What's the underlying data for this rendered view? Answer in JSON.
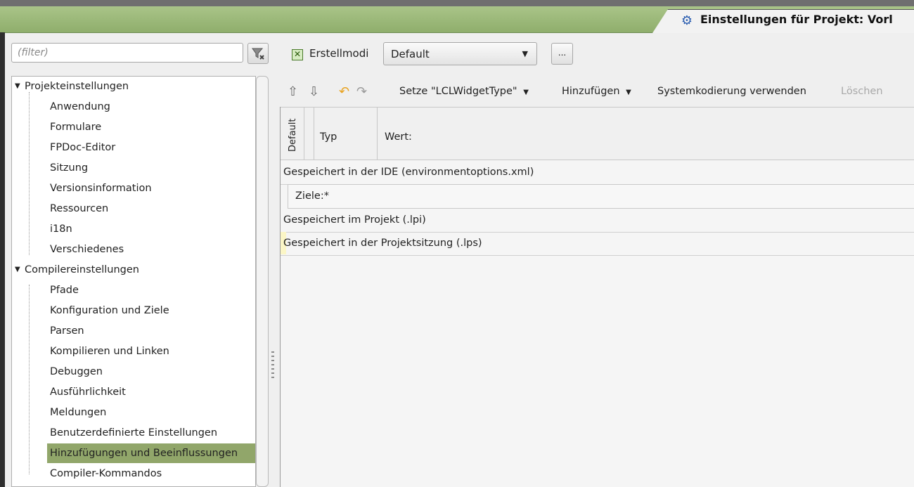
{
  "window": {
    "title": "Einstellungen für Projekt: Vorl",
    "title_icon": "gear-icon"
  },
  "sidebar": {
    "filter_placeholder": "(filter)",
    "filter_button_icon": "clear-filter-icon",
    "groups": [
      {
        "label": "Projekteinstellungen",
        "expanded": true,
        "items": [
          "Anwendung",
          "Formulare",
          "FPDoc-Editor",
          "Sitzung",
          "Versionsinformation",
          "Ressourcen",
          "i18n",
          "Verschiedenes"
        ]
      },
      {
        "label": "Compilereinstellungen",
        "expanded": true,
        "items": [
          "Pfade",
          "Konfiguration und Ziele",
          "Parsen",
          "Kompilieren und Linken",
          "Debuggen",
          "Ausführlichkeit",
          "Meldungen",
          "Benutzerdefinierte Einstellungen",
          "Hinzufügungen und Beeinflussungen",
          "Compiler-Kommandos"
        ]
      }
    ],
    "selected": "Hinzufügungen und Beeinflussungen",
    "selected_color": "#91a66a"
  },
  "buildmodes": {
    "checkbox_label": "Erstellmodi",
    "checked": true,
    "combo_value": "Default",
    "dots_label": "..."
  },
  "toolbar": {
    "move_up_icon": "arrow-up-icon",
    "move_down_icon": "arrow-down-icon",
    "undo_icon": "undo-icon",
    "redo_icon": "redo-icon",
    "set_widget_label": "Setze \"LCLWidgetType\"",
    "add_label": "Hinzufügen",
    "encoding_label": "Systemkodierung verwenden",
    "delete_label": "Löschen"
  },
  "grid": {
    "columns": [
      "Default",
      "Typ",
      "Wert:"
    ],
    "rows": [
      {
        "text": "Gespeichert in der IDE (environmentoptions.xml)",
        "level": 0
      },
      {
        "text": "Ziele:*",
        "level": 1
      },
      {
        "text": "Gespeichert im Projekt (.lpi)",
        "level": 0
      },
      {
        "text": "Gespeichert in der Projektsitzung (.lps)",
        "level": 0
      }
    ]
  },
  "colors": {
    "titlebar": "#9bb878",
    "selection": "#91a66a"
  }
}
